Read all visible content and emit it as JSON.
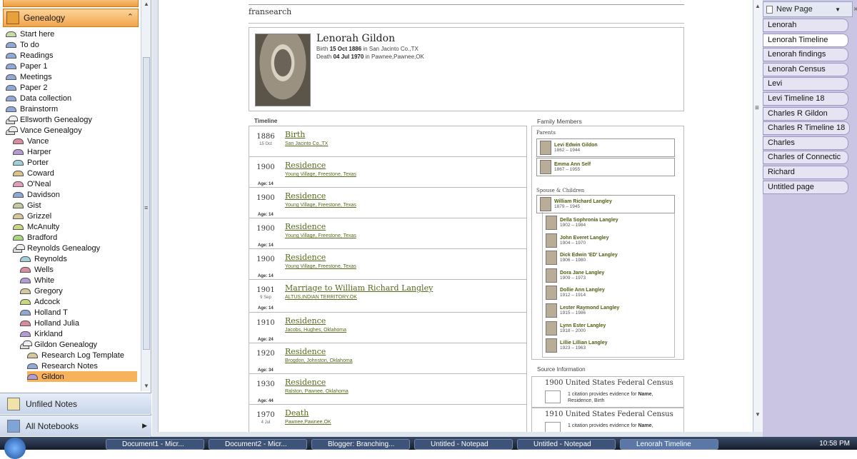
{
  "nav": {
    "notebook_title": "Genealogy",
    "items": [
      {
        "label": "Start here",
        "kind": "section",
        "color": "#c8d8a8",
        "indent": 0
      },
      {
        "label": "To do",
        "kind": "section",
        "color": "#8fa8d6",
        "indent": 0
      },
      {
        "label": "Readings",
        "kind": "section",
        "color": "#8fa8d6",
        "indent": 0
      },
      {
        "label": "Paper 1",
        "kind": "section",
        "color": "#8fa8d6",
        "indent": 0
      },
      {
        "label": "Meetings",
        "kind": "section",
        "color": "#8fa8d6",
        "indent": 0
      },
      {
        "label": "Paper 2",
        "kind": "section",
        "color": "#8fa8d6",
        "indent": 0
      },
      {
        "label": "Data collection",
        "kind": "section",
        "color": "#8fa8d6",
        "indent": 0
      },
      {
        "label": "Brainstorm",
        "kind": "section",
        "color": "#8fa8d6",
        "indent": 0
      },
      {
        "label": "Ellsworth Genealogy",
        "kind": "group",
        "color": "#dddddd",
        "indent": 0
      },
      {
        "label": "Vance Genealgoy",
        "kind": "group",
        "color": "#dddddd",
        "indent": 0
      },
      {
        "label": "Vance",
        "kind": "section",
        "color": "#d98c9e",
        "indent": 1
      },
      {
        "label": "Harper",
        "kind": "section",
        "color": "#b59ad6",
        "indent": 1
      },
      {
        "label": "Porter",
        "kind": "section",
        "color": "#9fd0d8",
        "indent": 1
      },
      {
        "label": "Coward",
        "kind": "section",
        "color": "#d9c48c",
        "indent": 1
      },
      {
        "label": "O'Neal",
        "kind": "section",
        "color": "#e0a0b8",
        "indent": 1
      },
      {
        "label": "Davidson",
        "kind": "section",
        "color": "#8fa8d6",
        "indent": 1
      },
      {
        "label": "Gist",
        "kind": "section",
        "color": "#c5c8a0",
        "indent": 1
      },
      {
        "label": "Grizzel",
        "kind": "section",
        "color": "#d6c89a",
        "indent": 1
      },
      {
        "label": "McAnulty",
        "kind": "section",
        "color": "#c8d880",
        "indent": 1
      },
      {
        "label": "Bradford",
        "kind": "section",
        "color": "#a8d880",
        "indent": 1
      },
      {
        "label": "Reynolds Genealogy",
        "kind": "group",
        "color": "#dddddd",
        "indent": 1
      },
      {
        "label": "Reynolds",
        "kind": "section",
        "color": "#9fd0d8",
        "indent": 2
      },
      {
        "label": "Wells",
        "kind": "section",
        "color": "#d98c9e",
        "indent": 2
      },
      {
        "label": "White",
        "kind": "section",
        "color": "#b59ad6",
        "indent": 2
      },
      {
        "label": "Gregory",
        "kind": "section",
        "color": "#d6c89a",
        "indent": 2
      },
      {
        "label": "Adcock",
        "kind": "section",
        "color": "#c8d880",
        "indent": 2
      },
      {
        "label": "Holland T",
        "kind": "section",
        "color": "#8fa8d6",
        "indent": 2
      },
      {
        "label": "Holland Julia",
        "kind": "section",
        "color": "#d98c9e",
        "indent": 2
      },
      {
        "label": "Kirkland",
        "kind": "section",
        "color": "#b59ad6",
        "indent": 2
      },
      {
        "label": "Gildon Genealogy",
        "kind": "group",
        "color": "#dddddd",
        "indent": 2
      },
      {
        "label": "Research Log Template",
        "kind": "section",
        "color": "#d6c89a",
        "indent": 3
      },
      {
        "label": "Research Notes",
        "kind": "section",
        "color": "#8fa8d6",
        "indent": 3
      },
      {
        "label": "Gildon",
        "kind": "section",
        "color": "#b59ad6",
        "indent": 3,
        "selected": true
      }
    ],
    "unfiled_label": "Unfiled Notes",
    "all_notebooks_label": "All Notebooks"
  },
  "page": {
    "site_name": "fransearch",
    "person": {
      "name": "Lenorah Gildon",
      "birth_label": "Birth",
      "birth_date": "15 Oct 1886",
      "birth_in": "in",
      "birth_place": "San Jacinto Co.,TX",
      "death_label": "Death",
      "death_date": "04 Jul 1970",
      "death_in": "in",
      "death_place": "Pawnee,Pawnee,OK"
    },
    "timeline_title": "Timeline",
    "timeline": [
      {
        "year": "1886",
        "sub": "15 Oct",
        "age": "",
        "event": "Birth",
        "place": "San Jacinto Co.,TX"
      },
      {
        "year": "1900",
        "sub": "",
        "age": "Age: 14",
        "event": "Residence",
        "place": "Young Village, Freestone, Texas"
      },
      {
        "year": "1900",
        "sub": "",
        "age": "Age: 14",
        "event": "Residence",
        "place": "Young Village, Freestone, Texas"
      },
      {
        "year": "1900",
        "sub": "",
        "age": "Age: 14",
        "event": "Residence",
        "place": "Young Village, Freestone, Texas"
      },
      {
        "year": "1900",
        "sub": "",
        "age": "Age: 14",
        "event": "Residence",
        "place": "Young Village, Freestone, Texas"
      },
      {
        "year": "1901",
        "sub": "9 Sep",
        "age": "Age: 14",
        "event": "Marriage to William Richard Langley",
        "place": "ALTUS,INDIAN TERRITORY,OK"
      },
      {
        "year": "1910",
        "sub": "",
        "age": "Age: 24",
        "event": "Residence",
        "place": "Jacobs, Hughes, Oklahoma"
      },
      {
        "year": "1920",
        "sub": "",
        "age": "Age: 34",
        "event": "Residence",
        "place": "Brogdon, Johnston, Oklahoma"
      },
      {
        "year": "1930",
        "sub": "",
        "age": "Age: 44",
        "event": "Residence",
        "place": "Ralston, Pawnee, Oklahoma"
      },
      {
        "year": "1970",
        "sub": "4 Jul",
        "age": "",
        "event": "Death",
        "place": "Pawnee,Pawnee,OK"
      }
    ],
    "family_title": "Family Members",
    "parents_label": "Parents",
    "parents": [
      {
        "name": "Levi Edwin Gildon",
        "dates": "1862 – 1944"
      },
      {
        "name": "Emma Ann Self",
        "dates": "1867 – 1955"
      }
    ],
    "spouse_label": "Spouse & Children",
    "spouse": {
      "name": "William Richard Langley",
      "dates": "1879 – 1945"
    },
    "children": [
      {
        "name": "Della Sophronia Langley",
        "dates": "1902 – 1984"
      },
      {
        "name": "John Everet Langley",
        "dates": "1904 – 1970"
      },
      {
        "name": "Dick Edwin 'ED' Langley",
        "dates": "1906 – 1980"
      },
      {
        "name": "Dora Jane Langley",
        "dates": "1909 – 1973"
      },
      {
        "name": "Dollie Ann Langley",
        "dates": "1912 – 1914"
      },
      {
        "name": "Lester Raymond Langley",
        "dates": "1915 – 1986"
      },
      {
        "name": "Lynn Ester Langley",
        "dates": "1918 – 2000"
      },
      {
        "name": "Lillie Lillian Langley",
        "dates": "1923 – 1963"
      }
    ],
    "source_title": "Source Information",
    "sources": [
      {
        "name": "1900 United States Federal Census",
        "text_a": "1 citation provides evidence for ",
        "bold_a": "Name",
        "text_b": ",",
        "rest": "Residence, Birth"
      },
      {
        "name": "1910 United States Federal Census",
        "text_a": "1 citation provides evidence for ",
        "bold_a": "Name",
        "text_b": ",",
        "rest": ""
      }
    ]
  },
  "page_tabs": {
    "new_page_label": "New Page",
    "tabs": [
      {
        "label": "Lenorah",
        "active": false
      },
      {
        "label": "Lenorah Timeline",
        "active": true
      },
      {
        "label": "Lenorah findings",
        "active": false
      },
      {
        "label": "Lenorah Census",
        "active": false
      },
      {
        "label": "Levi",
        "active": false
      },
      {
        "label": "Levi Timeline 18",
        "active": false
      },
      {
        "label": "Charles R Gildon",
        "active": false
      },
      {
        "label": "Charles R Timeline 18",
        "active": false
      },
      {
        "label": "Charles",
        "active": false
      },
      {
        "label": "Charles of Connectic",
        "active": false
      },
      {
        "label": "Richard",
        "active": false
      },
      {
        "label": "Untitled page",
        "active": false
      }
    ]
  },
  "taskbar": {
    "buttons": [
      {
        "label": "Document1 - Micr...",
        "active": false
      },
      {
        "label": "Document2 - Micr...",
        "active": false
      },
      {
        "label": "Blogger: Branching...",
        "active": false
      },
      {
        "label": "Untitled - Notepad",
        "active": false
      },
      {
        "label": "Untitled - Notepad",
        "active": false
      },
      {
        "label": "Lenorah Timeline",
        "active": true
      }
    ],
    "clock": "10:58 PM"
  }
}
